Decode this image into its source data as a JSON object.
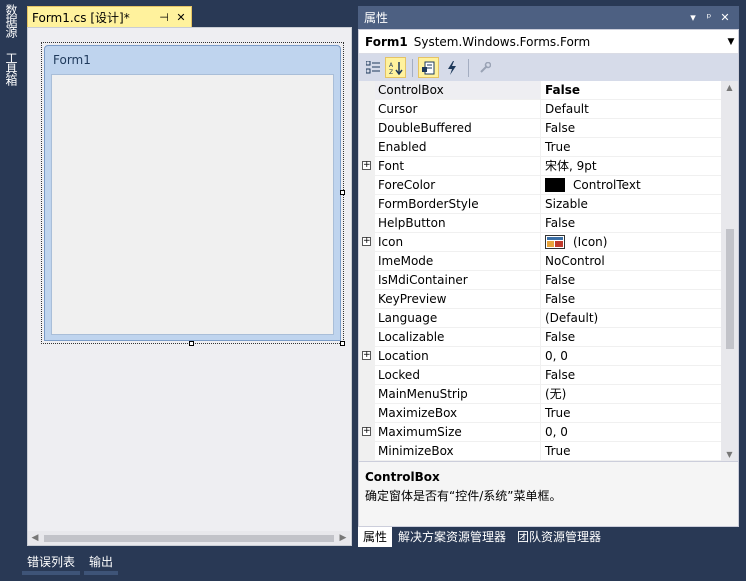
{
  "left_strip": {
    "tabs": [
      "数据源",
      "工具箱"
    ]
  },
  "document": {
    "tab_title": "Form1.cs [设计]*",
    "pin_glyph": "⊣",
    "close_glyph": "✕",
    "form_caption": "Form1"
  },
  "properties": {
    "title": "属性",
    "title_buttons": [
      "▾",
      "ᵖ",
      "✕"
    ],
    "object_name": "Form1",
    "object_type": "System.Windows.Forms.Form",
    "rows": [
      {
        "name": "ControlBox",
        "value": "False"
      },
      {
        "name": "Cursor",
        "value": "Default"
      },
      {
        "name": "DoubleBuffered",
        "value": "False"
      },
      {
        "name": "Enabled",
        "value": "True"
      },
      {
        "name": "Font",
        "value": "宋体, 9pt"
      },
      {
        "name": "ForeColor",
        "value": "ControlText"
      },
      {
        "name": "FormBorderStyle",
        "value": "Sizable"
      },
      {
        "name": "HelpButton",
        "value": "False"
      },
      {
        "name": "Icon",
        "value": "(Icon)"
      },
      {
        "name": "ImeMode",
        "value": "NoControl"
      },
      {
        "name": "IsMdiContainer",
        "value": "False"
      },
      {
        "name": "KeyPreview",
        "value": "False"
      },
      {
        "name": "Language",
        "value": "(Default)"
      },
      {
        "name": "Localizable",
        "value": "False"
      },
      {
        "name": "Location",
        "value": "0, 0"
      },
      {
        "name": "Locked",
        "value": "False"
      },
      {
        "name": "MainMenuStrip",
        "value": "(无)"
      },
      {
        "name": "MaximizeBox",
        "value": "True"
      },
      {
        "name": "MaximumSize",
        "value": "0, 0"
      },
      {
        "name": "MinimizeBox",
        "value": "True"
      }
    ],
    "description_title": "ControlBox",
    "description_text": "确定窗体是否有“控件/系统”菜单框。",
    "bottom_tabs": [
      "属性",
      "解决方案资源管理器",
      "团队资源管理器"
    ]
  },
  "bottom_tabs": [
    "错误列表",
    "输出"
  ],
  "colors": {
    "chrome": "#293955",
    "active_tab": "#FFF29D",
    "forecolor_swatch": "#000000"
  }
}
